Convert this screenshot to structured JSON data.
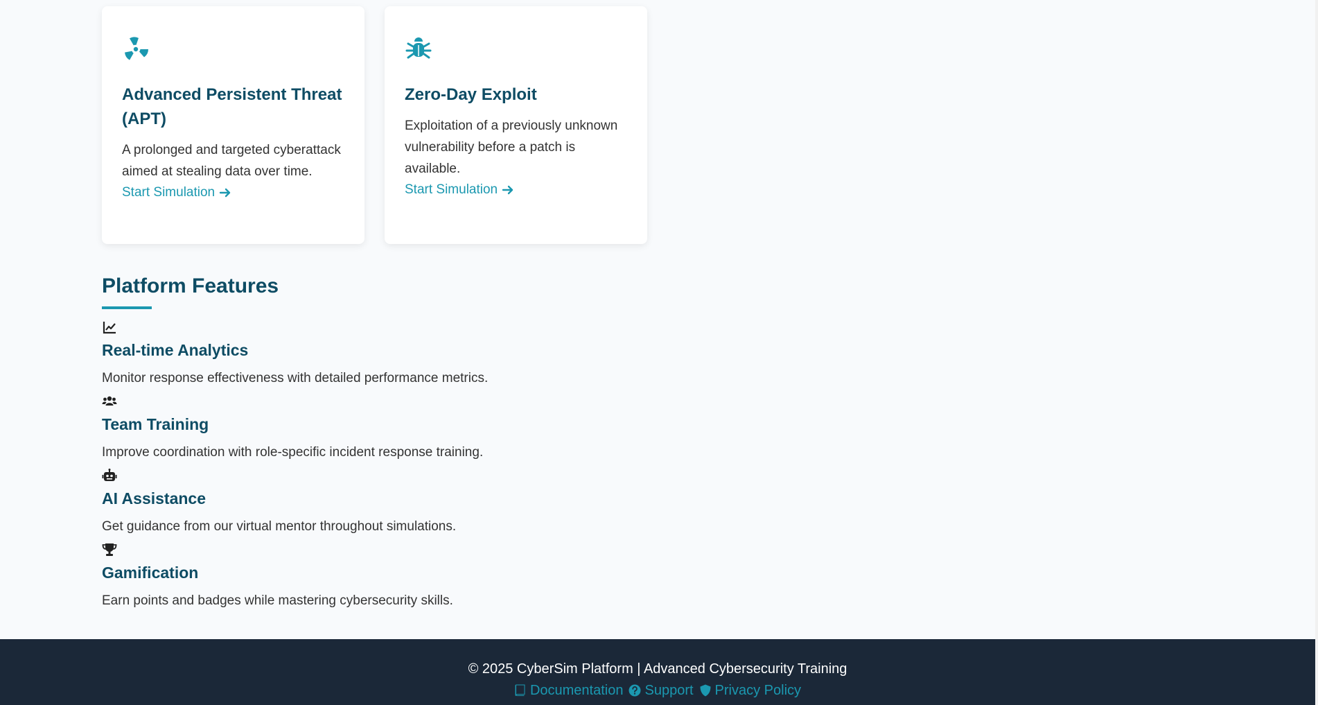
{
  "scenarios": [
    {
      "icon": "radiation-icon",
      "title": "Advanced Persistent Threat (APT)",
      "description": "A prolonged and targeted cyberattack aimed at stealing data over time.",
      "link_label": "Start Simulation"
    },
    {
      "icon": "bug-icon",
      "title": "Zero-Day Exploit",
      "description": "Exploitation of a previously unknown vulnerability before a patch is available.",
      "link_label": "Start Simulation"
    }
  ],
  "features": {
    "title": "Platform Features",
    "items": [
      {
        "icon": "chart-line-icon",
        "title": "Real-time Analytics",
        "description": "Monitor response effectiveness with detailed performance metrics."
      },
      {
        "icon": "users-icon",
        "title": "Team Training",
        "description": "Improve coordination with role-specific incident response training."
      },
      {
        "icon": "robot-icon",
        "title": "AI Assistance",
        "description": "Get guidance from our virtual mentor throughout simulations."
      },
      {
        "icon": "trophy-icon",
        "title": "Gamification",
        "description": "Earn points and badges while mastering cybersecurity skills."
      }
    ]
  },
  "footer": {
    "copyright": "© 2025 CyberSim Platform | Advanced Cybersecurity Training",
    "links": [
      {
        "icon": "book-icon",
        "label": "Documentation"
      },
      {
        "icon": "question-circle-icon",
        "label": "Support"
      },
      {
        "icon": "shield-icon",
        "label": "Privacy Policy"
      }
    ]
  },
  "colors": {
    "accent": "#1b98b0",
    "heading": "#0e4c64",
    "footer_bg": "#1b2838",
    "page_bg": "#f8fafc"
  }
}
